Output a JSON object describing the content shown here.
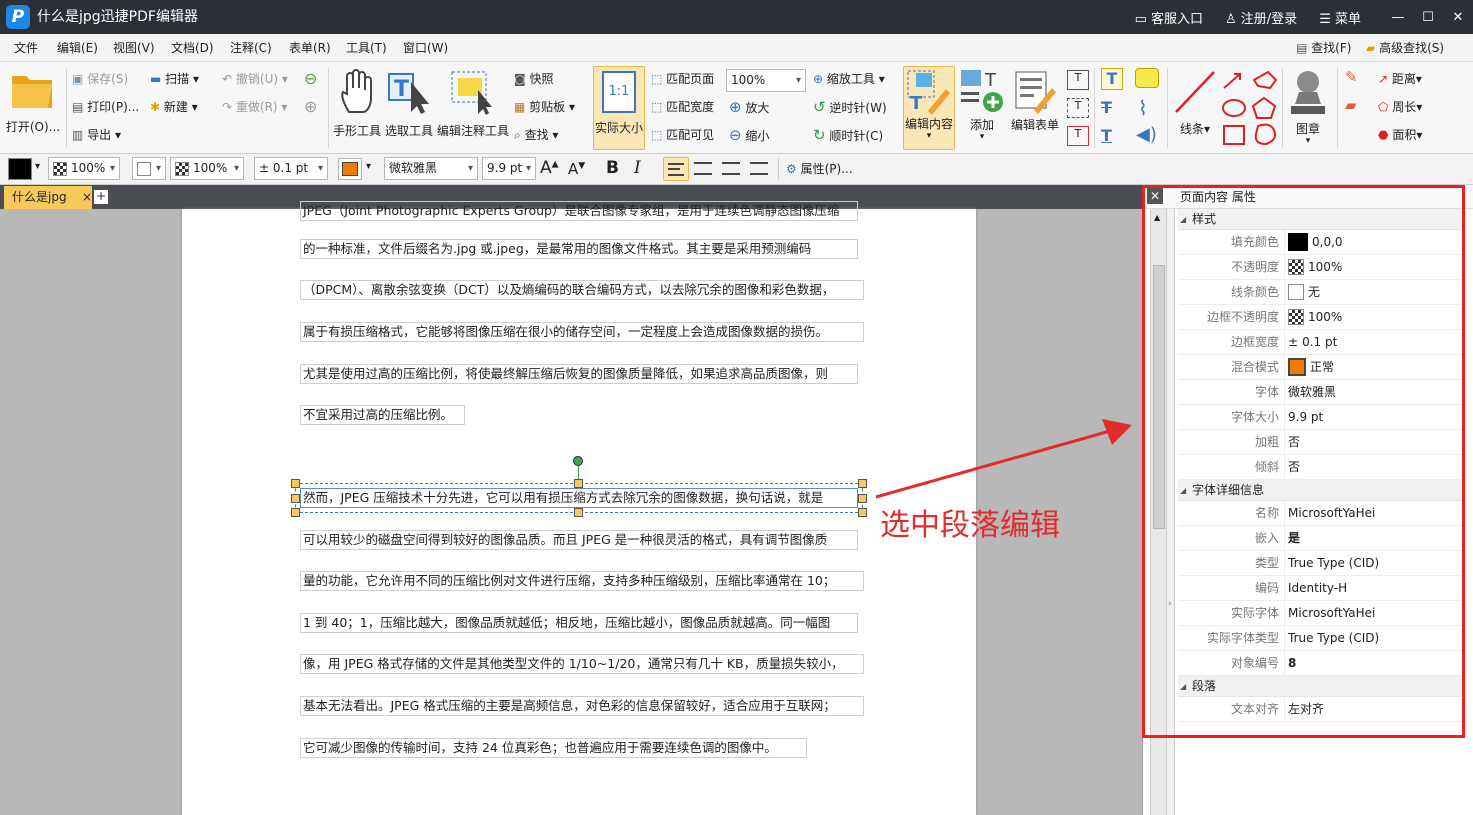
{
  "window": {
    "title": "什么是jpg迅捷PDF编辑器",
    "logo": "P",
    "customer": "客服入口",
    "login": "注册/登录",
    "menu": "菜单"
  },
  "menubar": {
    "items": [
      "文件",
      "编辑(E)",
      "视图(V)",
      "文档(D)",
      "注释(C)",
      "表单(R)",
      "工具(T)",
      "窗口(W)"
    ],
    "find": "查找(F)",
    "advfind": "高级查找(S)"
  },
  "ribbon": {
    "open": "打开(O)...",
    "save": "保存(S)",
    "print": "打印(P)...",
    "export": "导出",
    "scan": "扫描",
    "new": "新建",
    "undo": "撤销(U)",
    "redo": "重做(R)",
    "hand": "手形工具",
    "select": "选取工具",
    "annot_tool": "编辑注释工具",
    "snapshot": "快照",
    "clipboard": "剪贴板",
    "search": "查找",
    "actual": "实际大小",
    "fit_page": "匹配页面",
    "fit_width": "匹配宽度",
    "fit_visible": "匹配可见",
    "zoom_value": "100%",
    "zoom_tool": "缩放工具",
    "zoom_in": "放大",
    "zoom_out": "缩小",
    "rot_ccw": "逆时针(W)",
    "rot_cw": "顺时针(C)",
    "edit_content": "编辑内容",
    "add": "添加",
    "edit_form": "编辑表单",
    "lines": "线条",
    "stamp": "图章",
    "distance": "距离",
    "perimeter": "周长",
    "area": "面积",
    "actual_icon": "1:1"
  },
  "fmtbar": {
    "opacity1": "100%",
    "opacity2": "100%",
    "width": "0.1 pt",
    "font": "微软雅黑",
    "size": "9.9 pt",
    "bold": "B",
    "italic": "I",
    "props": "属性(P)..."
  },
  "tabs": {
    "doc": "什么是jpg",
    "close": "×",
    "add": "+"
  },
  "document": {
    "paragraphs": [
      "JPEG（Joint Photographic Experts Group）是联合图像专家组，是用于连续色调静态图像压缩",
      "的一种标准，文件后缀名为.jpg 或.jpeg，是最常用的图像文件格式。其主要是采用预测编码",
      "（DPCM）、离散余弦变换（DCT）以及熵编码的联合编码方式，以去除冗余的图像和彩色数据，",
      "属于有损压缩格式，它能够将图像压缩在很小的储存空间，一定程度上会造成图像数据的损伤。",
      "尤其是使用过高的压缩比例，将使最终解压缩后恢复的图像质量降低，如果追求高品质图像，则",
      "不宜采用过高的压缩比例。",
      "然而，JPEG 压缩技术十分先进，它可以用有损压缩方式去除冗余的图像数据，换句话说，就是",
      "可以用较少的磁盘空间得到较好的图像品质。而且 JPEG 是一种很灵活的格式，具有调节图像质",
      "量的功能，它允许用不同的压缩比例对文件进行压缩，支持多种压缩级别，压缩比率通常在 10；",
      "1 到 40；1，压缩比越大，图像品质就越低；相反地，压缩比越小，图像品质就越高。同一幅图",
      "像，用 JPEG 格式存储的文件是其他类型文件的 1/10~1/20，通常只有几十 KB，质量损失较小，",
      "基本无法看出。JPEG 格式压缩的主要是高频信息，对色彩的信息保留较好，适合应用于互联网；",
      "它可减少图像的传输时间，支持 24 位真彩色；也普遍应用于需要连续色调的图像中。"
    ]
  },
  "annotation": {
    "text": "选中段落编辑",
    "color": "#e32b2b"
  },
  "panel": {
    "title": "页面内容 属性",
    "close": "✕",
    "sections": {
      "style": "样式",
      "fontinfo": "字体详细信息",
      "para": "段落"
    },
    "style_rows": [
      {
        "k": "填充颜色",
        "v": "0,0,0"
      },
      {
        "k": "不透明度",
        "v": "100%"
      },
      {
        "k": "线条颜色",
        "v": "无"
      },
      {
        "k": "边框不透明度",
        "v": "100%"
      },
      {
        "k": "边框宽度",
        "v": "0.1 pt"
      },
      {
        "k": "混合模式",
        "v": "正常"
      },
      {
        "k": "字体",
        "v": "微软雅黑"
      },
      {
        "k": "字体大小",
        "v": "9.9 pt"
      },
      {
        "k": "加粗",
        "v": "否"
      },
      {
        "k": "倾斜",
        "v": "否"
      }
    ],
    "font_rows": [
      {
        "k": "名称",
        "v": "MicrosoftYaHei"
      },
      {
        "k": "嵌入",
        "v": "是"
      },
      {
        "k": "类型",
        "v": "True Type (CID)"
      },
      {
        "k": "编码",
        "v": "Identity-H"
      },
      {
        "k": "实际字体",
        "v": "MicrosoftYaHei"
      },
      {
        "k": "实际字体类型",
        "v": "True Type (CID)"
      },
      {
        "k": "对象编号",
        "v": "8"
      }
    ],
    "para_rows": [
      {
        "k": "文本对齐",
        "v": "左对齐"
      }
    ]
  },
  "colors": {
    "accent": "#f6c95a",
    "highlight_border": "#f01f1f",
    "titlebar": "#2b2f36",
    "fill_swatch": "#000000",
    "blend_swatch": "#f07d00"
  }
}
